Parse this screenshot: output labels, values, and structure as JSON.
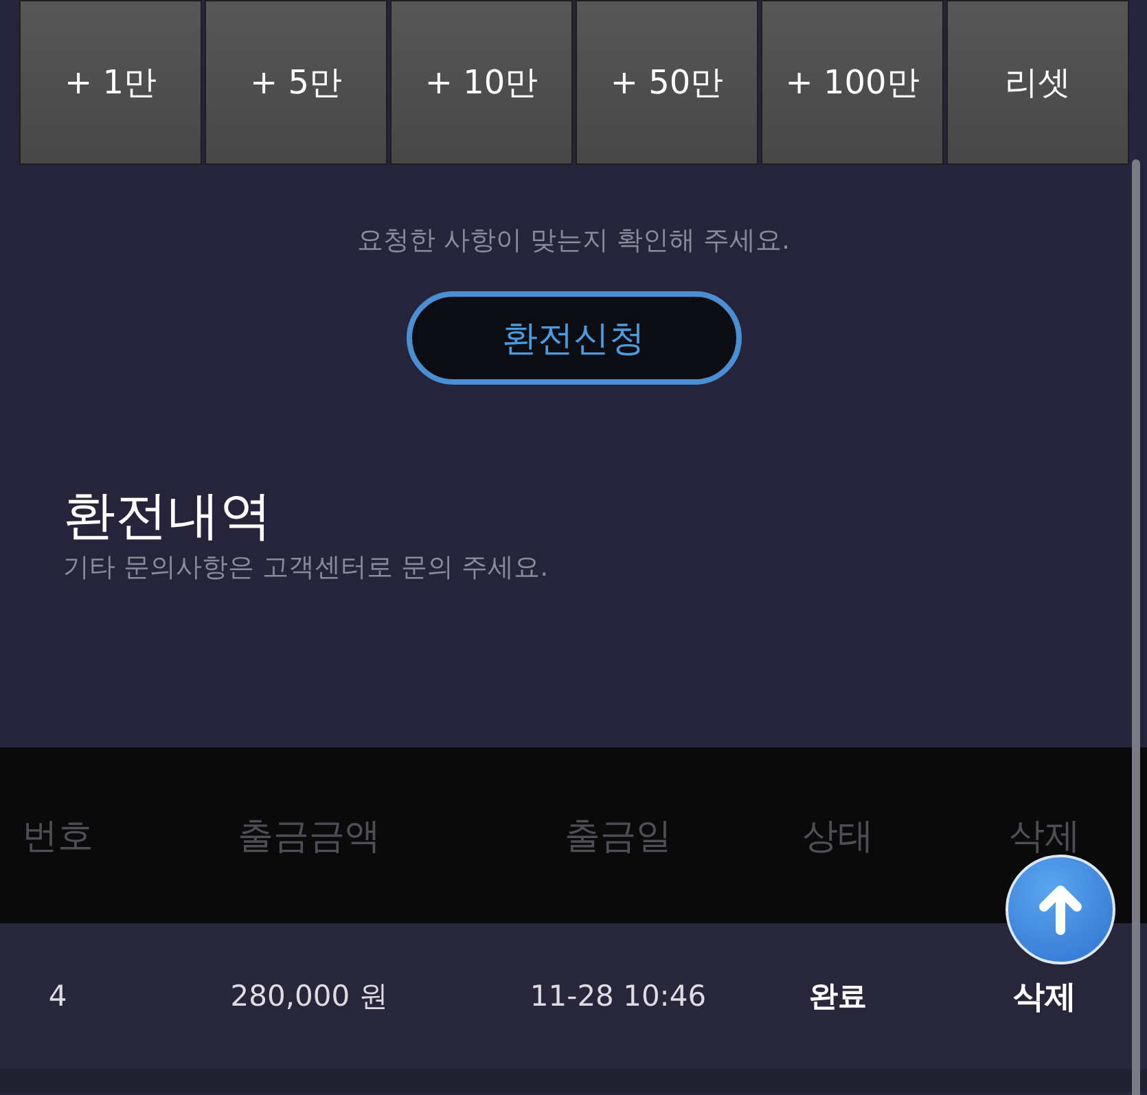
{
  "amount_buttons": [
    "+ 1만",
    "+ 5만",
    "+ 10만",
    "+ 50만",
    "+ 100만",
    "리셋"
  ],
  "confirm_notice": "요청한 사항이 맞는지 확인해 주세요.",
  "submit_button": "환전신청",
  "history": {
    "title": "환전내역",
    "subtitle": "기타 문의사항은 고객센터로 문의 주세요."
  },
  "table": {
    "columns": [
      "번호",
      "출금금액",
      "출금일",
      "상태",
      "삭제"
    ],
    "rows": [
      {
        "number": "4",
        "amount": "280,000 원",
        "date": "11-28 10:46",
        "status": "완료",
        "delete": "삭제"
      }
    ]
  }
}
